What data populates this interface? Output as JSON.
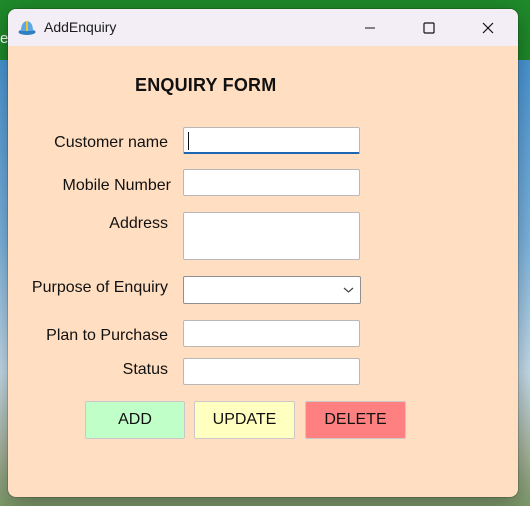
{
  "background": {
    "partial_letter": "e"
  },
  "window": {
    "title": "AddEnquiry",
    "icon": "app-hat-icon",
    "controls": {
      "minimize": "minimize-icon",
      "maximize": "maximize-icon",
      "close": "close-icon"
    }
  },
  "form": {
    "title": "ENQUIRY FORM",
    "fields": {
      "customer_name": {
        "label": "Customer name",
        "value": ""
      },
      "mobile_number": {
        "label": "Mobile Number",
        "value": ""
      },
      "address": {
        "label": "Address",
        "value": ""
      },
      "purpose": {
        "label": "Purpose of Enquiry",
        "value": ""
      },
      "plan_to_purchase": {
        "label": "Plan to Purchase",
        "value": ""
      },
      "status": {
        "label": "Status",
        "value": ""
      }
    },
    "buttons": {
      "add": "ADD",
      "update": "UPDATE",
      "delete": "DELETE"
    }
  },
  "colors": {
    "form_background": "#ffdec1",
    "add_button": "#c0ffc8",
    "update_button": "#ffffc0",
    "delete_button": "#ff8080",
    "focus_accent": "#1e64b4"
  }
}
